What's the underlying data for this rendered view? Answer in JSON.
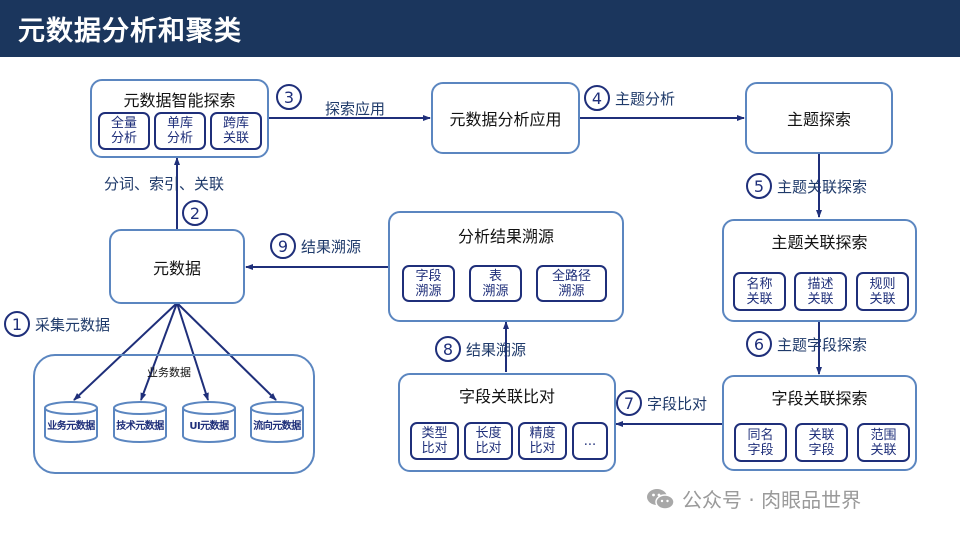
{
  "page": {
    "title": "元数据分析和聚类"
  },
  "colors": {
    "header_bg": "#1b365d",
    "box_border": "#5b86c0",
    "accent": "#1f2f7a",
    "label_text": "#1f3a6a",
    "watermark": "#9a9a9a"
  },
  "nodes": {
    "smart_explore": {
      "title": "元数据智能探索",
      "items": [
        "全量\n分析",
        "单库\n分析",
        "跨库\n关联"
      ]
    },
    "analysis_app": {
      "title": "元数据分析应用"
    },
    "topic_explore": {
      "title": "主题探索"
    },
    "topic_relation": {
      "title": "主题关联探索",
      "items": [
        "名称\n关联",
        "描述\n关联",
        "规则\n关联"
      ]
    },
    "field_relation_explore": {
      "title": "字段关联探索",
      "items": [
        "同名\n字段",
        "关联\n字段",
        "范围\n关联"
      ]
    },
    "field_compare": {
      "title": "字段关联比对",
      "items": [
        "类型\n比对",
        "长度\n比对",
        "精度\n比对",
        "..."
      ]
    },
    "result_trace": {
      "title": "分析结果溯源",
      "items": [
        "字段\n溯源",
        "表\n溯源",
        "全路径\n溯源"
      ]
    },
    "metadata": {
      "title": "元数据"
    },
    "business_data": {
      "title": "业务数据",
      "databases": [
        "业务元数据",
        "技术元数据",
        "UI元数据",
        "流向元数据"
      ]
    }
  },
  "steps": [
    {
      "num": "1",
      "label": "采集元数据"
    },
    {
      "num": "2",
      "label": ""
    },
    {
      "num": "3",
      "label": ""
    },
    {
      "num": "4",
      "label": "主题分析"
    },
    {
      "num": "5",
      "label": "主题关联探索"
    },
    {
      "num": "6",
      "label": "主题字段探索"
    },
    {
      "num": "7",
      "label": "字段比对"
    },
    {
      "num": "8",
      "label": "结果溯源"
    },
    {
      "num": "9",
      "label": "结果溯源"
    }
  ],
  "edge_labels": {
    "explore_app": "探索应用",
    "tokenize": "分词、索引、关联"
  },
  "watermark": {
    "text": "公众号 · 肉眼品世界",
    "icon": "wechat-icon"
  }
}
